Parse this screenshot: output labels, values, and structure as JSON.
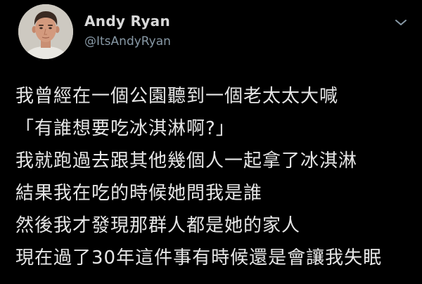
{
  "tweet": {
    "display_name": "Andy Ryan",
    "handle": "@ItsAndyRyan",
    "avatar_icon": "profile-photo",
    "menu_icon": "chevron-down-icon",
    "lines": [
      "我曾經在一個公園聽到一個老太太大喊",
      "「有誰想要吃冰淇淋啊?」",
      "我就跑過去跟其他幾個人一起拿了冰淇淋",
      "結果我在吃的時候她問我是誰",
      "然後我才發現那群人都是她的家人",
      "現在過了30年這件事有時候還是會讓我失眠"
    ]
  },
  "colors": {
    "background": "#000000",
    "text": "#e6e6e6",
    "name": "#d9d9d9",
    "handle": "#8899a6"
  }
}
